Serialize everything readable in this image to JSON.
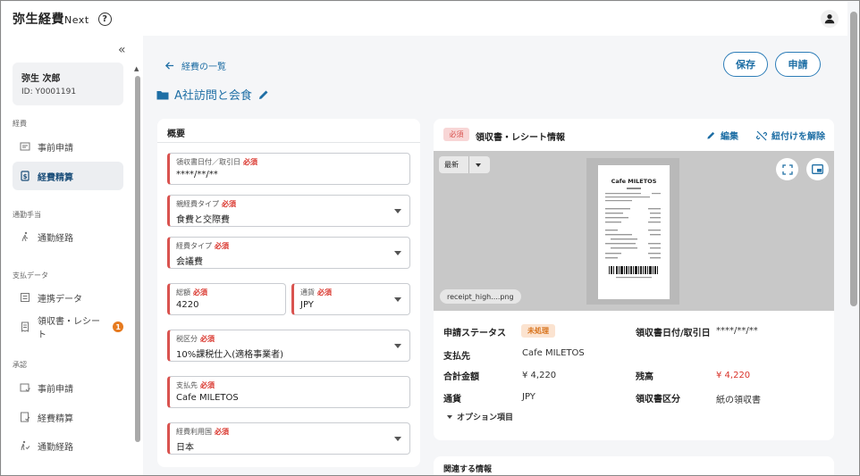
{
  "app": {
    "name": "弥生経費",
    "name_suffix": "Next",
    "help": "?"
  },
  "sidebar": {
    "user": {
      "name": "弥生 次郎",
      "id": "ID: Y0001191"
    },
    "sections": [
      {
        "label": "経費",
        "items": [
          {
            "label": "事前申請"
          },
          {
            "label": "経費精算"
          }
        ]
      },
      {
        "label": "通勤手当",
        "items": [
          {
            "label": "通勤経路"
          }
        ]
      },
      {
        "label": "支払データ",
        "items": [
          {
            "label": "連携データ"
          },
          {
            "label": "領収書・レシート",
            "badge": "1"
          }
        ]
      },
      {
        "label": "承認",
        "items": [
          {
            "label": "事前申請"
          },
          {
            "label": "経費精算"
          },
          {
            "label": "通勤経路"
          }
        ]
      }
    ]
  },
  "main": {
    "back_label": "経費の一覧",
    "title": "A社訪問と会食",
    "save_label": "保存",
    "submit_label": "申請",
    "overview": {
      "title": "概要",
      "required": "必須",
      "fields": {
        "date": {
          "label": "領収書日付／取引日",
          "value": "****/**/**"
        },
        "category_type": {
          "label": "親経費タイプ",
          "value": "食費と交際費"
        },
        "expense_type": {
          "label": "経費タイプ",
          "value": "会議費"
        },
        "amount": {
          "label": "総額",
          "value": "4220"
        },
        "currency": {
          "label": "通貨",
          "value": "JPY"
        },
        "tax": {
          "label": "税区分",
          "value": "10%課税仕入(適格事業者)"
        },
        "payee": {
          "label": "支払先",
          "value": "Cafe MILETOS"
        },
        "country": {
          "label": "経費利用国",
          "value": "日本"
        }
      }
    },
    "receipt": {
      "required": "必須",
      "title": "領収書・レシート情報",
      "edit_label": "編集",
      "unlink_label": "紐付けを解除",
      "latest_label": "最新",
      "filename": "receipt_high....png",
      "receipt_shop": "Cafe MILETOS",
      "info": {
        "status_label": "申請ステータス",
        "status_value": "未処理",
        "date_label": "領収書日付/取引日",
        "date_value": "****/**/**",
        "payee_label": "支払先",
        "payee_value": "Cafe MILETOS",
        "total_label": "合計金額",
        "total_value": "¥ 4,220",
        "balance_label": "残高",
        "balance_value": "¥ 4,220",
        "currency_label": "通貨",
        "currency_value": "JPY",
        "type_label": "領収書区分",
        "type_value": "紙の領収書",
        "options_label": "オプション項目"
      }
    },
    "related": {
      "title": "関連する情報"
    }
  },
  "colors": {
    "accent": "#1f6fa5",
    "required": "#d9342b",
    "badge": "#e67a1f",
    "balance": "#d9342b"
  }
}
